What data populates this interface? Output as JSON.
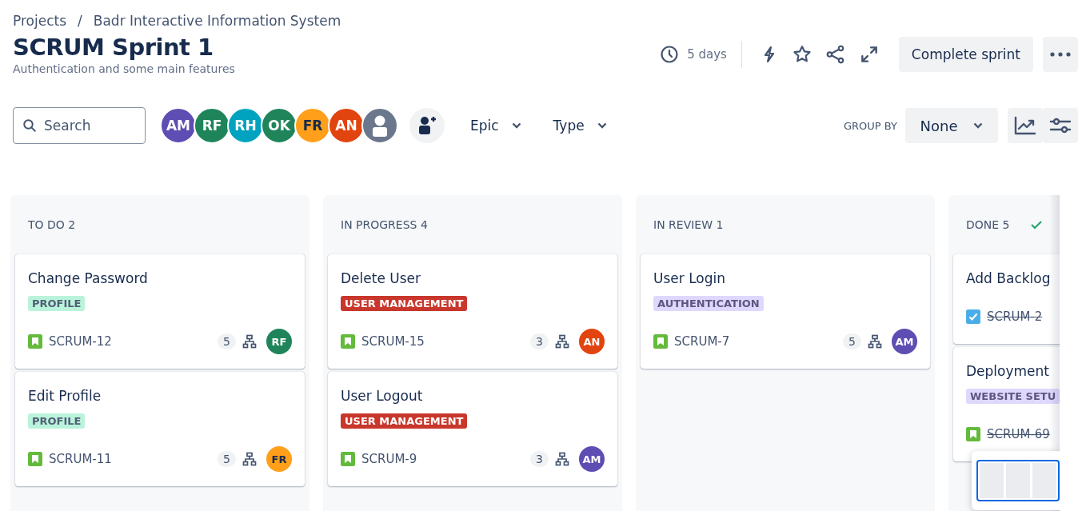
{
  "breadcrumbs": [
    {
      "label": "Projects"
    },
    {
      "label": "Badr Interactive Information System"
    }
  ],
  "breadcrumb_separator": "/",
  "title": "SCRUM Sprint 1",
  "subtitle": "Authentication and some main features",
  "time_remaining": "5 days",
  "complete_button": "Complete sprint",
  "search": {
    "placeholder": "Search"
  },
  "people": [
    {
      "initials": "AM",
      "color": "#5e4db2"
    },
    {
      "initials": "RF",
      "color": "#1f845a"
    },
    {
      "initials": "RH",
      "color": "#00a3bf"
    },
    {
      "initials": "OK",
      "color": "#1f845a"
    },
    {
      "initials": "FR",
      "color": "#ff9f1a"
    },
    {
      "initials": "AN",
      "color": "#e2440f"
    }
  ],
  "filters": [
    {
      "label": "Epic"
    },
    {
      "label": "Type"
    }
  ],
  "group_by": {
    "label": "GROUP BY",
    "value": "None"
  },
  "columns": [
    {
      "title": "TO DO 2",
      "done": false,
      "cards": [
        {
          "title": "Change Password",
          "kind": "story",
          "tag": {
            "label": "PROFILE",
            "color": "#baf3db"
          },
          "key": "SCRUM-12",
          "resolved": false,
          "estimate": "5",
          "assignee": {
            "initials": "RF",
            "color": "#1f845a"
          }
        },
        {
          "title": "Edit Profile",
          "kind": "story",
          "tag": {
            "label": "PROFILE",
            "color": "#baf3db"
          },
          "key": "SCRUM-11",
          "resolved": false,
          "estimate": "5",
          "assignee": {
            "initials": "FR",
            "color": "#ff9f1a"
          }
        }
      ]
    },
    {
      "title": "IN PROGRESS 4",
      "done": false,
      "cards": [
        {
          "title": "Delete User",
          "kind": "story",
          "tag": {
            "label": "USER MANAGEMENT",
            "color": "#c9372c"
          },
          "key": "SCRUM-15",
          "resolved": false,
          "estimate": "3",
          "assignee": {
            "initials": "AN",
            "color": "#e2440f"
          }
        },
        {
          "title": "User Logout",
          "kind": "story",
          "tag": {
            "label": "USER MANAGEMENT",
            "color": "#c9372c"
          },
          "key": "SCRUM-9",
          "resolved": false,
          "estimate": "3",
          "assignee": {
            "initials": "AM",
            "color": "#5e4db2"
          }
        }
      ]
    },
    {
      "title": "IN REVIEW 1",
      "done": false,
      "cards": [
        {
          "title": "User Login",
          "kind": "story",
          "tag": {
            "label": "AUTHENTICATION",
            "color": "#dfd8fd"
          },
          "key": "SCRUM-7",
          "resolved": false,
          "estimate": "5",
          "assignee": {
            "initials": "AM",
            "color": "#5e4db2"
          }
        }
      ]
    },
    {
      "title": "DONE 5",
      "done": true,
      "cards": [
        {
          "title": "Add Backlog",
          "kind": "task",
          "key": "SCRUM-2",
          "resolved": true
        },
        {
          "title": "Deployment",
          "kind": "story",
          "tag": {
            "label": "WEBSITE SETU",
            "color": "#dfd8fd"
          },
          "key": "SCRUM-69",
          "resolved": true
        }
      ]
    }
  ]
}
